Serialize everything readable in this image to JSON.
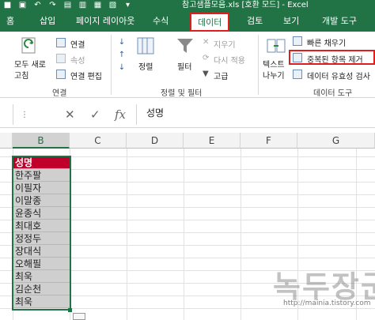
{
  "window": {
    "title": "참고샘플모음.xls [호환 모드] - Excel"
  },
  "tabs": [
    "홈",
    "삽입",
    "페이지 레이아웃",
    "수식",
    "데이터",
    "검토",
    "보기",
    "개발 도구"
  ],
  "ribbon": {
    "connections_group": {
      "refresh_all_label": "모두 새로\n고침",
      "connections": "연결",
      "properties": "속성",
      "edit_links": "연결 편집",
      "label": "연결"
    },
    "sort_filter_group": {
      "sort": "정렬",
      "filter": "필터",
      "clear": "지우기",
      "reapply": "다시 적용",
      "advanced": "고급",
      "label": "정렬 및 필터"
    },
    "data_tools_group": {
      "text_to_columns": "텍스트\n나누기",
      "flash_fill": "빠른 채우기",
      "remove_duplicates": "중복된 항목 제거",
      "data_validation": "데이터 유효성 검사",
      "label": "데이터 도구"
    }
  },
  "formula_bar": {
    "value": "성명",
    "cancel_icon": "x-icon",
    "enter_icon": "check-icon",
    "fx_label": "fx"
  },
  "columns": [
    "B",
    "C",
    "D",
    "E",
    "F",
    "G"
  ],
  "cells": {
    "header": "성명",
    "names": [
      "한주팔",
      "이필자",
      "이말종",
      "윤종식",
      "최대호",
      "정정두",
      "장대식",
      "오해필",
      "최욱",
      "김순천",
      "최욱"
    ]
  },
  "watermark": {
    "text": "녹두장군",
    "url": "http://mainia.tistory.com"
  },
  "colors": {
    "excel_green": "#217346",
    "header_fill": "#c0002b",
    "highlight_red": "#e01e1e"
  }
}
